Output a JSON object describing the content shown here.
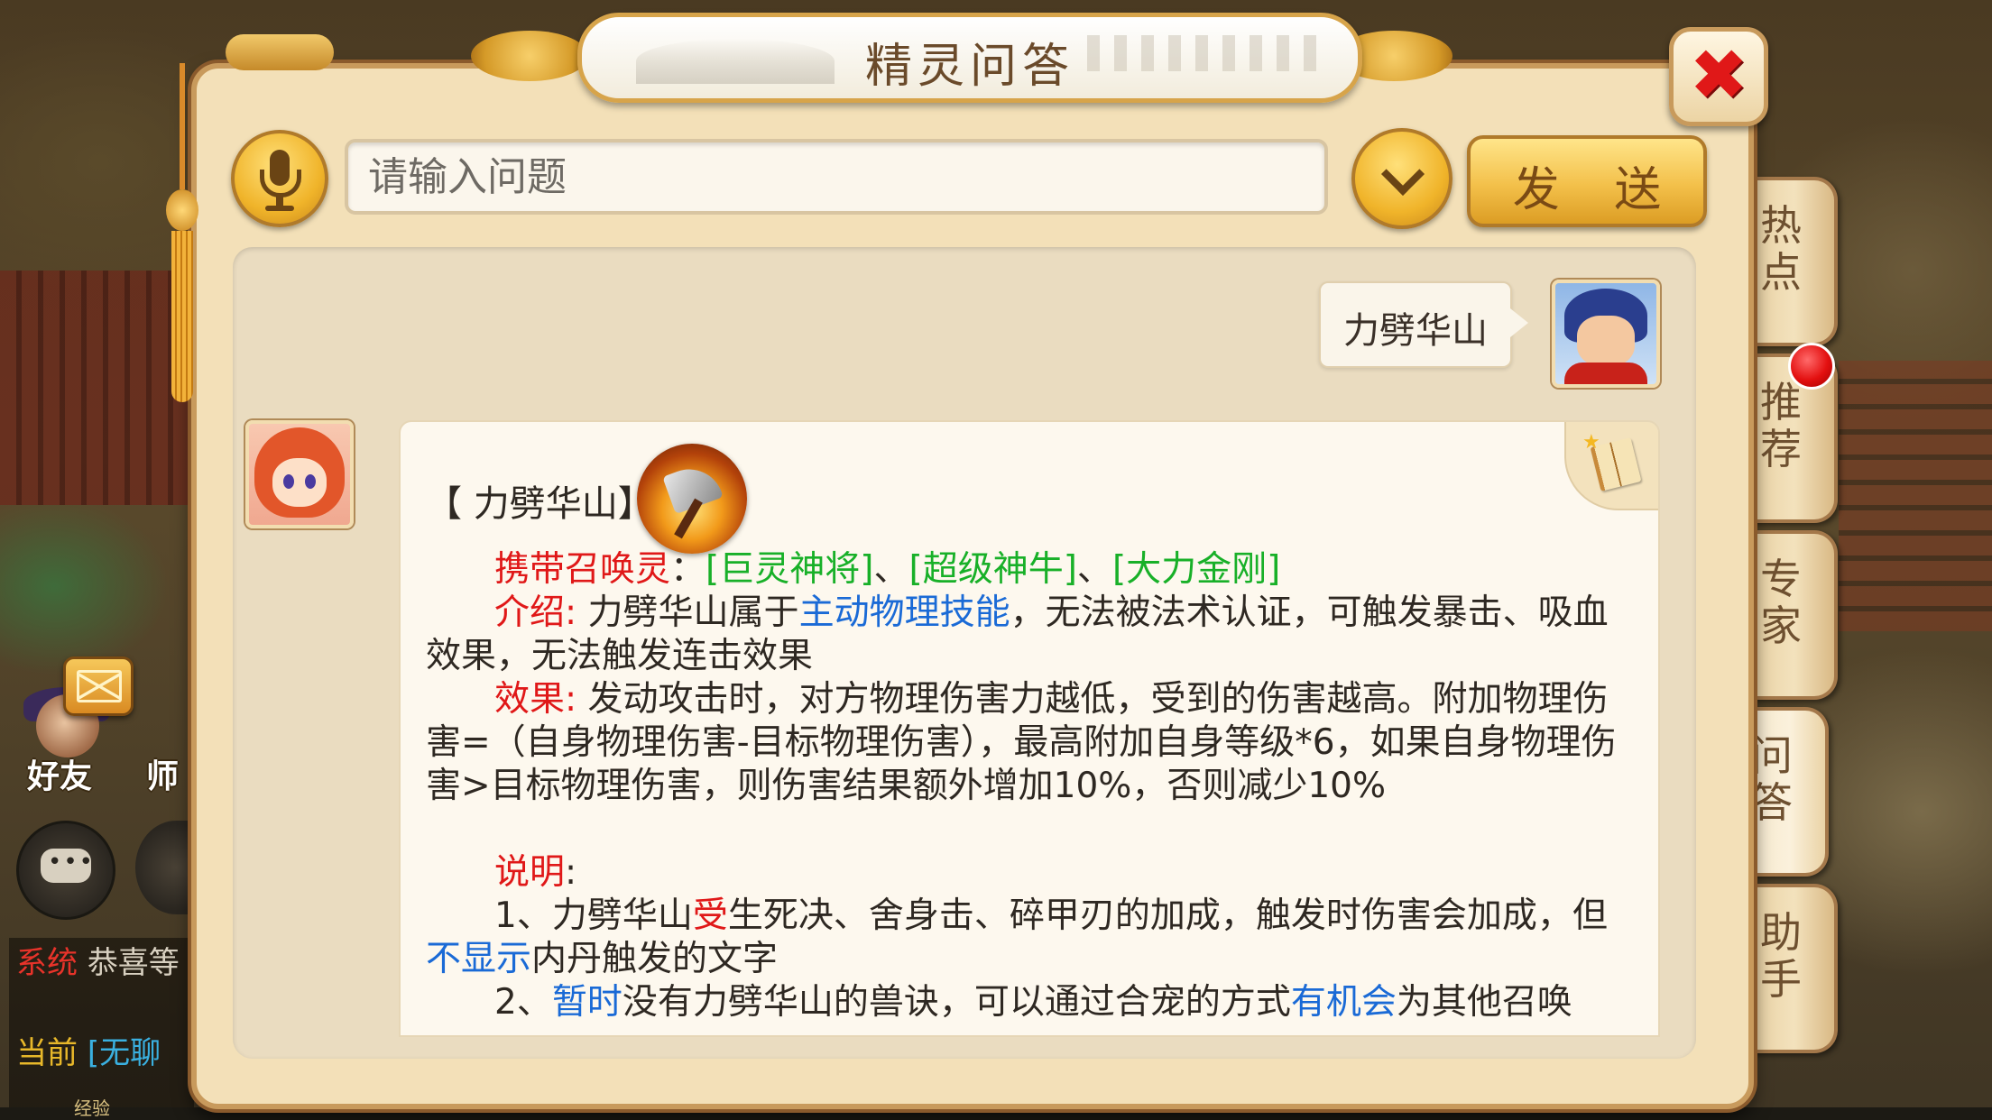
{
  "window": {
    "title": "精灵问答",
    "close_symbol": "✖"
  },
  "search": {
    "placeholder": "请输入问题",
    "value": ""
  },
  "buttons": {
    "send": "发 送"
  },
  "side_tabs": [
    {
      "label": "热点",
      "active": false
    },
    {
      "label": "推荐",
      "active": false,
      "has_notification": true
    },
    {
      "label": "专家",
      "active": false
    },
    {
      "label": "问答",
      "active": true
    },
    {
      "label": "助手",
      "active": false
    }
  ],
  "hud": {
    "friend_label": "好友",
    "teacher_label": "师",
    "chat": [
      {
        "channel": "系统",
        "text": "恭喜等"
      },
      {
        "channel": "当前",
        "text": "[无聊"
      }
    ],
    "exp_label": "经验"
  },
  "conversation": {
    "user_message": "力劈华山",
    "answer": {
      "title": "【 力劈华山】",
      "carry_label": "携带召唤灵",
      "carry_sep": "：",
      "carry_values": [
        "[巨灵神将]",
        "、",
        "[超级神牛]",
        "、",
        "[大力金刚]"
      ],
      "intro_label": "介绍",
      "intro_sep": ":",
      "intro_pre": " 力劈华山属于",
      "intro_link": "主动物理技能",
      "intro_post": "，无法被法术认证，可触发暴击、吸血效果，无法触发连击效果",
      "effect_label": "效果",
      "effect_sep": ":",
      "effect_text": " 发动攻击时，对方物理伤害力越低，受到的伤害越高。附加物理伤害=（自身物理伤害-目标物理伤害），最高附加自身等级*6，如果自身物理伤害>目标物理伤害，则伤害结果额外增加10%，否则减少10%",
      "note_label": "说明",
      "note_sep": ":",
      "note1_pre": "1、力劈华山",
      "note1_red": "受",
      "note1_mid": "生死决、舍身击、碎甲刃的加成，触发时伤害会加成，但",
      "note1_blue": "不显示",
      "note1_post": "内丹触发的文字",
      "note2_pre": "2、",
      "note2_blue1": "暂时",
      "note2_mid": "没有力劈华山的兽诀，可以通过合宠的方式",
      "note2_blue2": "有机会",
      "note2_post": "为其他召唤"
    }
  },
  "colors": {
    "label_red": "#e01818",
    "value_green": "#18b028",
    "link_blue": "#1a6ad6",
    "panel_bg": "#f3e0b8"
  }
}
